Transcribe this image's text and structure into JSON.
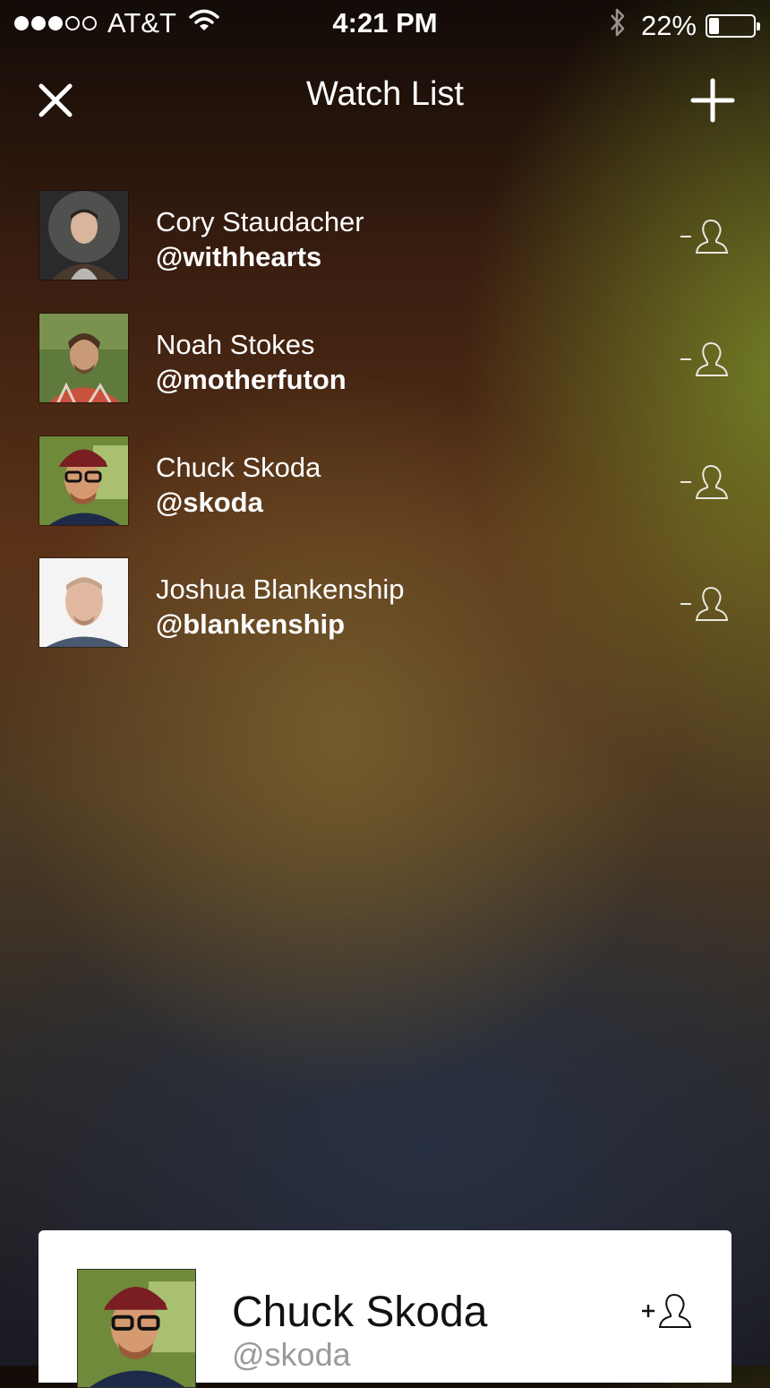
{
  "status_bar": {
    "carrier": "AT&T",
    "time": "4:21 PM",
    "battery": "22%",
    "battery_level": 0.22,
    "signal_bars_filled": 3,
    "signal_bars_total": 5
  },
  "nav": {
    "title": "Watch List",
    "close_icon": "close-icon",
    "add_icon": "plus-icon"
  },
  "watch_list": [
    {
      "name": "Cory Staudacher",
      "handle": "@withhearts"
    },
    {
      "name": "Noah Stokes",
      "handle": "@motherfuton"
    },
    {
      "name": "Chuck Skoda",
      "handle": "@skoda"
    },
    {
      "name": "Joshua Blankenship",
      "handle": "@blankenship"
    }
  ],
  "row_action_icon": "remove-user-icon",
  "profile_card": {
    "name": "Chuck Skoda",
    "handle": "@skoda",
    "action_icon": "add-user-icon"
  },
  "colors": {
    "text": "#ffffff",
    "card_background": "#ffffff",
    "card_handle": "#9a9a9a",
    "accent_green": "#7a8c28",
    "accent_brown": "#5a3218"
  }
}
